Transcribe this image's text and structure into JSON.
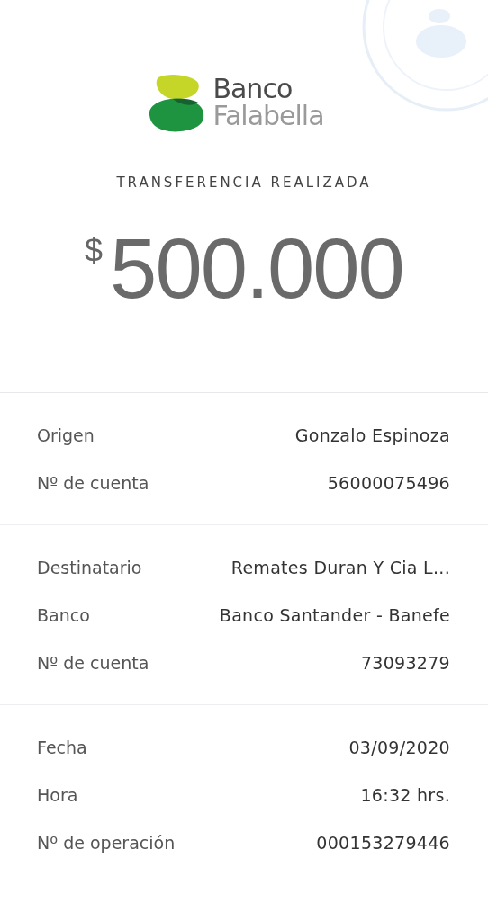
{
  "logo": {
    "line_1": "Banco",
    "line_2": "Falabella"
  },
  "title": "TRANSFERENCIA REALIZADA",
  "amount": {
    "currency": "$",
    "value": "500.000"
  },
  "sections": [
    {
      "rows": [
        {
          "label": "Origen",
          "value": "Gonzalo Espinoza"
        },
        {
          "label": "Nº de cuenta",
          "value": "56000075496"
        }
      ]
    },
    {
      "rows": [
        {
          "label": "Destinatario",
          "value": "Remates Duran Y Cia L..."
        },
        {
          "label": "Banco",
          "value": "Banco Santander - Banefe"
        },
        {
          "label": "Nº de cuenta",
          "value": "73093279"
        }
      ]
    },
    {
      "rows": [
        {
          "label": "Fecha",
          "value": "03/09/2020"
        },
        {
          "label": "Hora",
          "value": "16:32 hrs."
        },
        {
          "label": "Nº de operación",
          "value": "000153279446"
        }
      ]
    }
  ]
}
